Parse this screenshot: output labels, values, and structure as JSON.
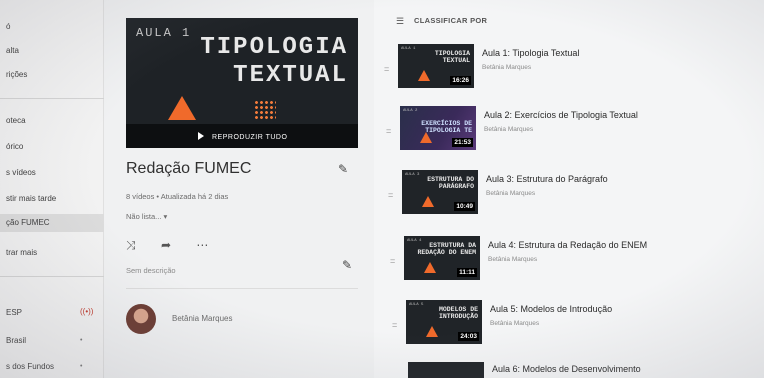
{
  "sidebar": {
    "items": [
      {
        "label": "ó"
      },
      {
        "label": "alta"
      },
      {
        "label": "rições"
      },
      {
        "label": "oteca"
      },
      {
        "label": "órico"
      },
      {
        "label": "s vídeos"
      },
      {
        "label": "stir mais tarde"
      },
      {
        "label": "ção FUMEC"
      },
      {
        "label": "trar mais"
      },
      {
        "label": "ESP"
      },
      {
        "label": "Brasil"
      },
      {
        "label": "s dos Fundos"
      }
    ]
  },
  "playlist": {
    "thumb_aula": "AULA 1",
    "thumb_title_line1": "TIPOLOGIA",
    "thumb_title_line2": "TEXTUAL",
    "play_all": "REPRODUZIR TUDO",
    "title": "Redação FUMEC",
    "meta": "8 vídeos • Atualizada há 2 dias",
    "privacy": "Não lista... ▾",
    "description": "Sem descrição",
    "owner": "Betânia Marques"
  },
  "list": {
    "sort_label": "CLASSIFICAR POR",
    "videos": [
      {
        "title": "Aula 1: Tipologia Textual",
        "owner": "Betânia Marques",
        "thumb_text": "TIPOLOGIA TEXTUAL",
        "duration": "16:26"
      },
      {
        "title": "Aula 2: Exercícios de Tipologia Textual",
        "owner": "Betânia Marques",
        "thumb_text": "EXERCÍCIOS DE TIPOLOGIA TE",
        "duration": "21:53"
      },
      {
        "title": "Aula 3: Estrutura do Parágrafo",
        "owner": "Betânia Marques",
        "thumb_text": "ESTRUTURA DO PARÁGRAFO",
        "duration": "10:49"
      },
      {
        "title": "Aula 4: Estrutura da Redação do ENEM",
        "owner": "Betânia Marques",
        "thumb_text": "ESTRUTURA DA REDAÇÃO DO ENEM",
        "duration": "11:11"
      },
      {
        "title": "Aula 5: Modelos de Introdução",
        "owner": "Betânia Marques",
        "thumb_text": "MODELOS DE INTRODUÇÃO",
        "duration": "24:03"
      },
      {
        "title": "Aula 6: Modelos de Desenvolvimento",
        "owner": "",
        "thumb_text": "",
        "duration": ""
      }
    ]
  }
}
